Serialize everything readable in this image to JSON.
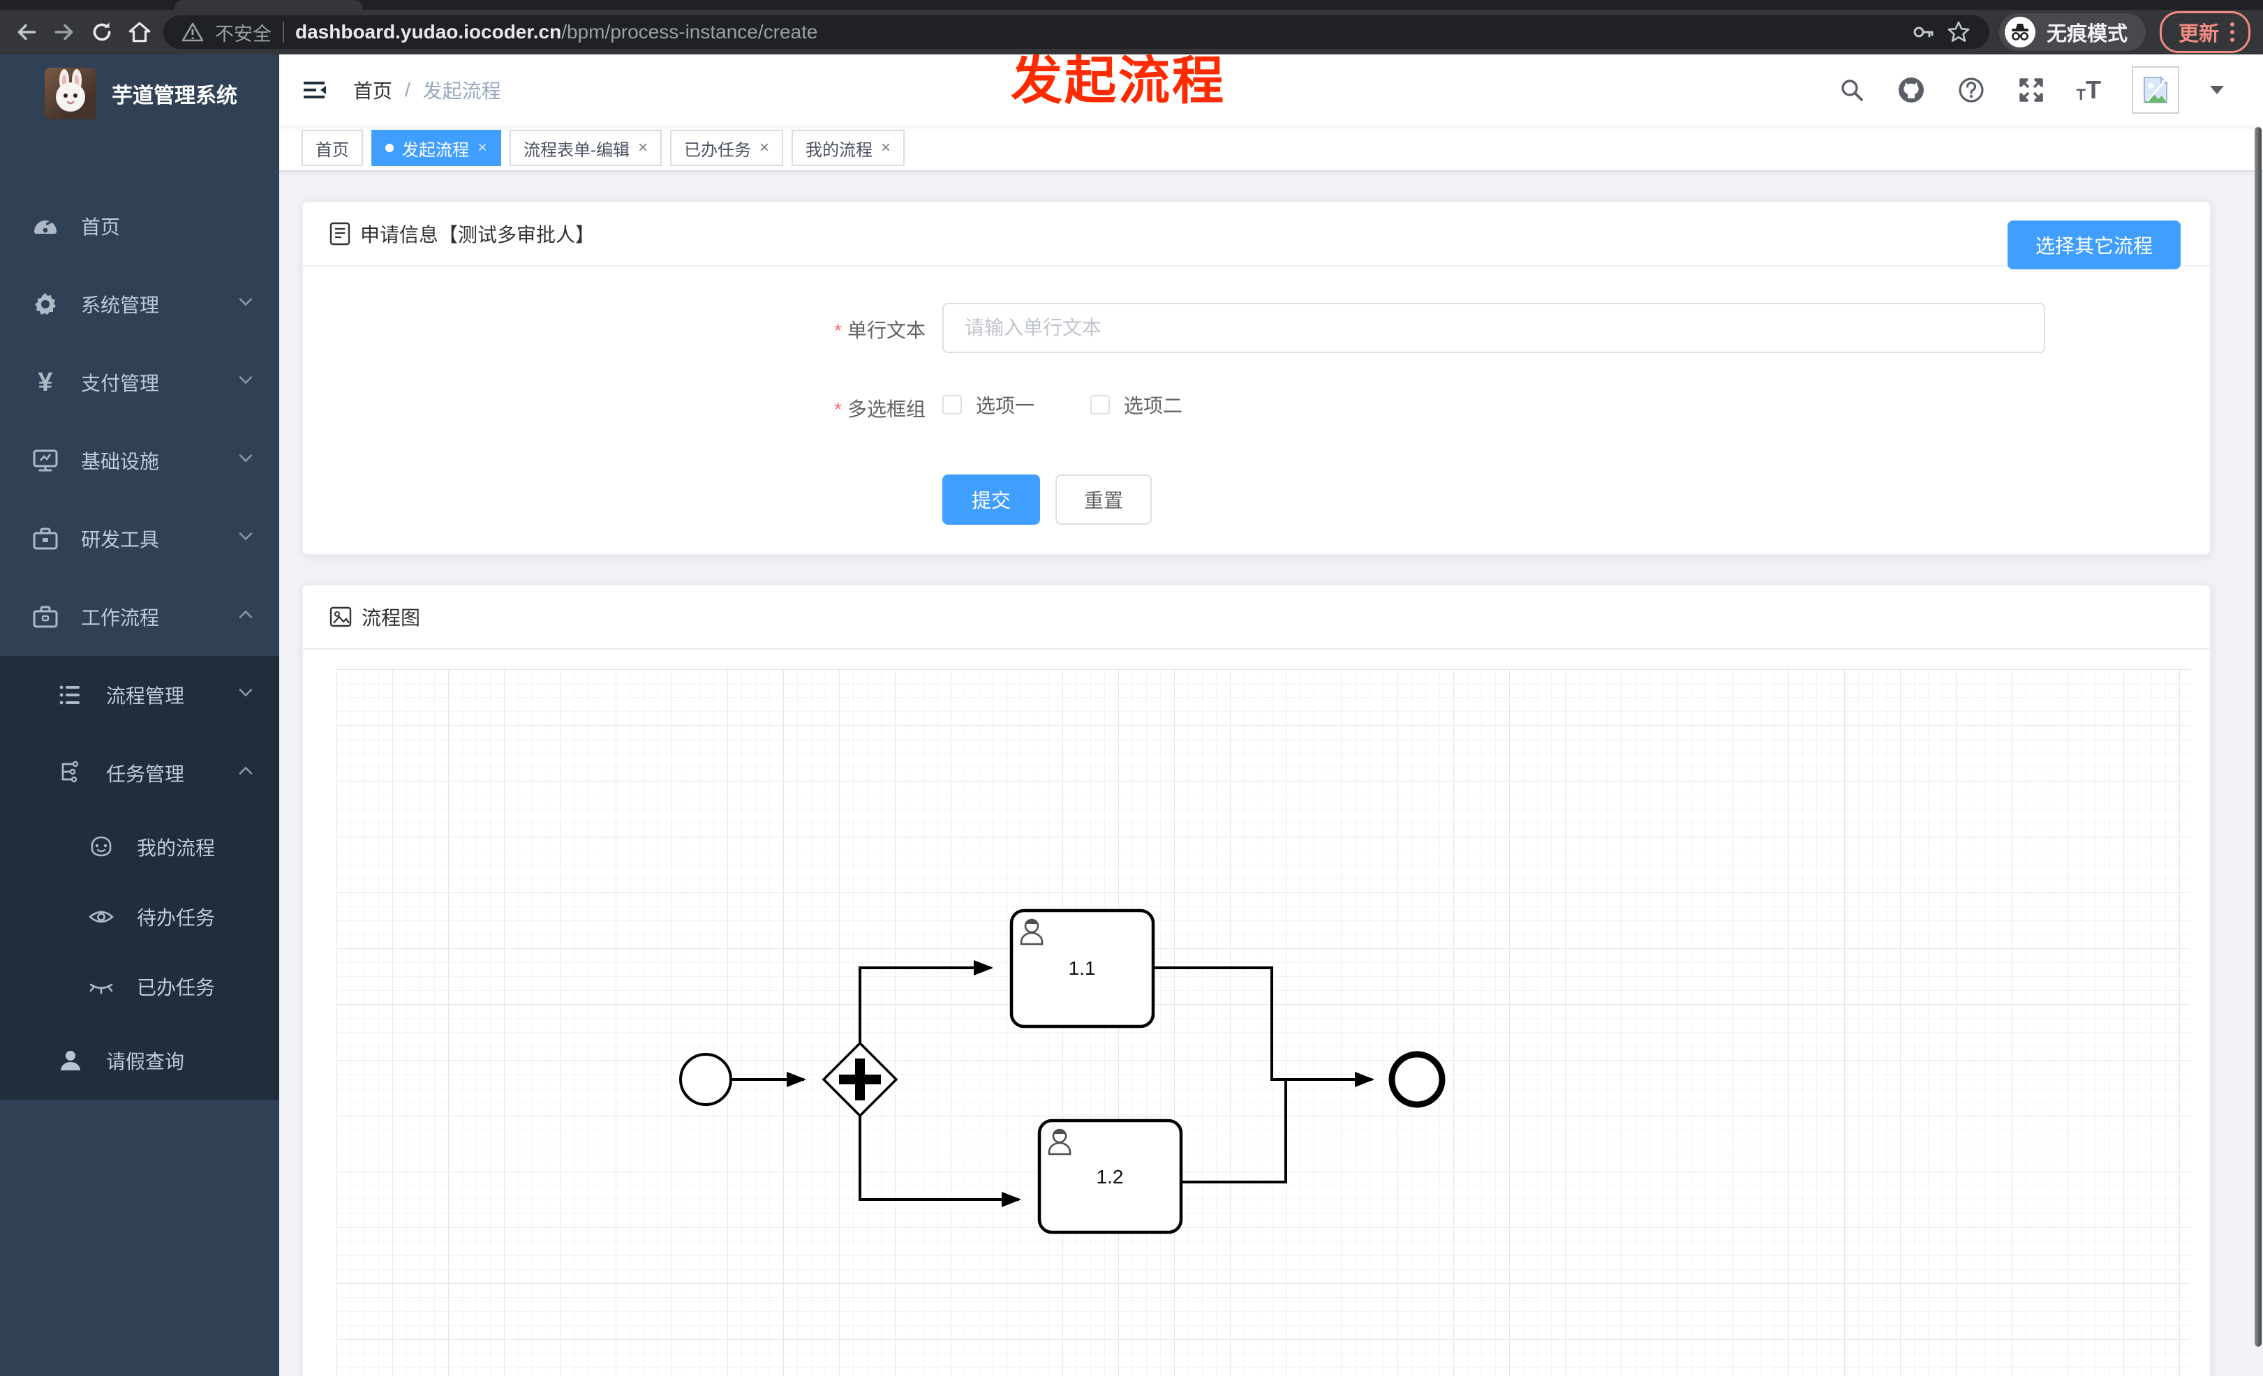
{
  "browser": {
    "security_label": "不安全",
    "url_domain": "dashboard.yudao.iocoder.cn",
    "url_path": "/bpm/process-instance/create",
    "incognito_label": "无痕模式",
    "update_label": "更新"
  },
  "annotation": {
    "text": "发起流程",
    "color": "#fe2b00"
  },
  "sidebar": {
    "logo_title": "芋道管理系统",
    "items": [
      {
        "label": "首页",
        "icon": "gauge-icon",
        "chevron": "none"
      },
      {
        "label": "系统管理",
        "icon": "gear-icon",
        "chevron": "down"
      },
      {
        "label": "支付管理",
        "icon": "yen-icon",
        "chevron": "down"
      },
      {
        "label": "基础设施",
        "icon": "monitor-icon",
        "chevron": "down"
      },
      {
        "label": "研发工具",
        "icon": "toolbox-icon",
        "chevron": "down"
      },
      {
        "label": "工作流程",
        "icon": "briefcase-icon",
        "chevron": "up"
      }
    ],
    "submenu": [
      {
        "label": "流程管理",
        "icon": "tree-icon",
        "chevron": "down"
      },
      {
        "label": "任务管理",
        "icon": "flow-icon",
        "chevron": "up"
      },
      {
        "label": "我的流程",
        "icon": "robot-face-icon",
        "chevron": "none"
      },
      {
        "label": "待办任务",
        "icon": "eye-open-icon",
        "chevron": "none"
      },
      {
        "label": "已办任务",
        "icon": "eye-closed-icon",
        "chevron": "none"
      },
      {
        "label": "请假查询",
        "icon": "user-icon",
        "chevron": "none"
      }
    ]
  },
  "header": {
    "breadcrumb": [
      {
        "label": "首页"
      },
      {
        "label": "发起流程"
      }
    ],
    "separator": "/"
  },
  "tags": [
    {
      "label": "首页",
      "active": false,
      "closable": false
    },
    {
      "label": "发起流程",
      "active": true,
      "closable": true
    },
    {
      "label": "流程表单-编辑",
      "active": false,
      "closable": true
    },
    {
      "label": "已办任务",
      "active": false,
      "closable": true
    },
    {
      "label": "我的流程",
      "active": false,
      "closable": true
    }
  ],
  "form_card": {
    "title": "申请信息【测试多审批人】",
    "choose_other_label": "选择其它流程",
    "fields": [
      {
        "label": "单行文本",
        "required": true,
        "placeholder": "请输入单行文本",
        "value": ""
      },
      {
        "label": "多选框组",
        "required": true,
        "options": [
          {
            "label": "选项一",
            "checked": false
          },
          {
            "label": "选项二",
            "checked": false
          }
        ]
      }
    ],
    "submit_label": "提交",
    "reset_label": "重置"
  },
  "diagram_card": {
    "title": "流程图",
    "nodes": {
      "start": "start-event",
      "gateway": "parallel-gateway",
      "task1": "1.1",
      "task2": "1.2",
      "end": "end-event"
    }
  },
  "ui": {
    "close_glyph": "×"
  },
  "colors": {
    "accent": "#409eff",
    "sidebar_bg": "#304156",
    "submenu_bg": "#1f2d3d",
    "annotation_red": "#fe2b00"
  }
}
